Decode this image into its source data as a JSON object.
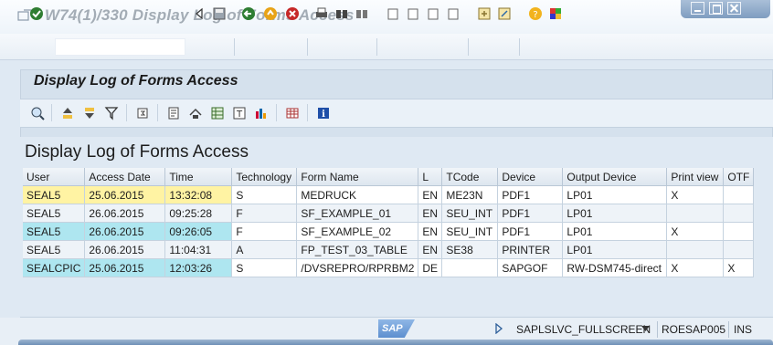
{
  "window": {
    "title": "W74(1)/330 Display Log of Forms Access"
  },
  "icons": {
    "title": "sap-window-icon",
    "enter": "green-check-icon",
    "back": "back-icon",
    "exit": "exit-icon",
    "cancel": "cancel-icon",
    "save": "save-icon",
    "print": "print-icon",
    "find": "find-icon",
    "help": "help-icon"
  },
  "colors": {
    "key_cell": "#aee6f0",
    "selected_cell": "#fff3a3",
    "panel": "#d5e1ed"
  },
  "panel": {
    "title": "Display Log of Forms Access"
  },
  "grid": {
    "title": "Display Log of Forms Access",
    "columns": [
      "User",
      "Access Date",
      "Time",
      "Technology",
      "Form Name",
      "L",
      "TCode",
      "Device",
      "Output Device",
      "Print view",
      "OTF"
    ],
    "rows": [
      [
        "SEAL5",
        "25.06.2015",
        "13:32:08",
        "S",
        "MEDRUCK",
        "EN",
        "ME23N",
        "PDF1",
        "LP01",
        "X",
        ""
      ],
      [
        "SEAL5",
        "26.06.2015",
        "09:25:28",
        "F",
        "SF_EXAMPLE_01",
        "EN",
        "SEU_INT",
        "PDF1",
        "LP01",
        "",
        ""
      ],
      [
        "SEAL5",
        "26.06.2015",
        "09:26:05",
        "F",
        "SF_EXAMPLE_02",
        "EN",
        "SEU_INT",
        "PDF1",
        "LP01",
        "X",
        ""
      ],
      [
        "SEAL5",
        "26.06.2015",
        "11:04:31",
        "A",
        "FP_TEST_03_TABLE",
        "EN",
        "SE38",
        "PRINTER",
        "LP01",
        "",
        ""
      ],
      [
        "SEALCPIC",
        "25.06.2015",
        "12:03:26",
        "S",
        "/DVSREPRO/RPRBM2",
        "DE",
        "",
        "SAPGOF",
        "RW-DSM745-direct",
        "X",
        "X"
      ]
    ]
  },
  "status": {
    "logo": "SAP",
    "program": "SAPLSLVC_FULLSCREEN",
    "server": "ROESAP005",
    "mode": "INS"
  }
}
